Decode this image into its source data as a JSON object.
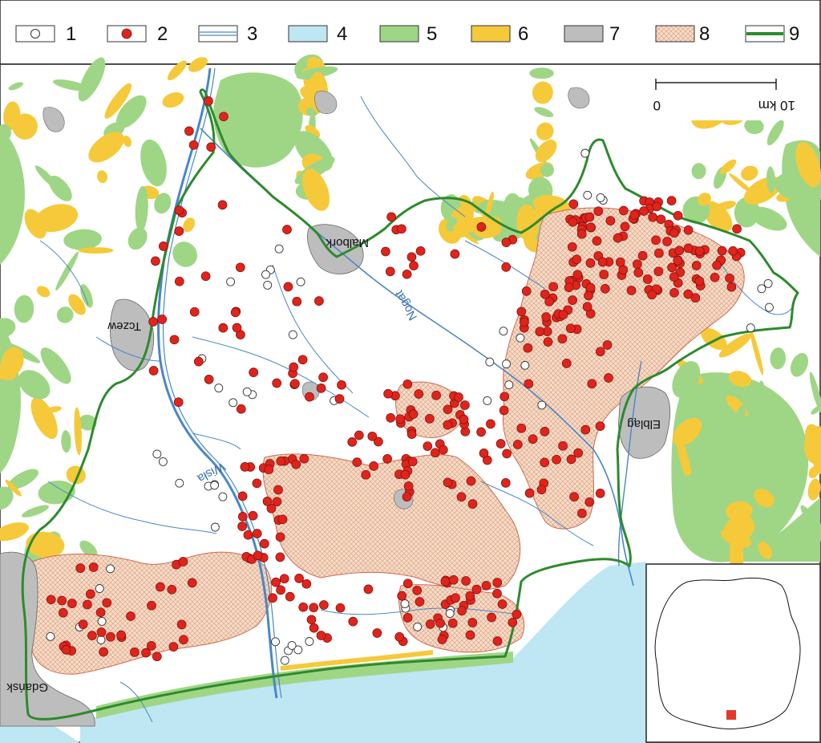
{
  "legend": {
    "items": [
      {
        "label": "1",
        "kind": "open-circle"
      },
      {
        "label": "2",
        "kind": "red-dot"
      },
      {
        "label": "3",
        "kind": "river-line"
      },
      {
        "label": "4",
        "kind": "water"
      },
      {
        "label": "5",
        "kind": "forest"
      },
      {
        "label": "6",
        "kind": "yellow-area"
      },
      {
        "label": "7",
        "kind": "urban"
      },
      {
        "label": "8",
        "kind": "hatched-area"
      },
      {
        "label": "9",
        "kind": "boundary-line"
      }
    ]
  },
  "colors": {
    "red_dot": "#e0241b",
    "water": "#bfe6f3",
    "forest": "#9fd686",
    "yellow": "#f5c93a",
    "urban": "#bdbdbd",
    "hatch_fill": "#f6dcc6",
    "hatch_line": "#cf6a4f",
    "boundary": "#2d8a2d",
    "river": "#4a86c8",
    "inset_marker": "#e33b2a"
  },
  "places": {
    "malbork": "Malbork",
    "tczew": "Tczew",
    "elblag": "Elbląg",
    "gdansk": "Gdańsk"
  },
  "rivers": {
    "wisla": "Wisła",
    "nogat": "Nogat"
  },
  "scale": {
    "left_value": "0",
    "right_value": "10 km"
  }
}
